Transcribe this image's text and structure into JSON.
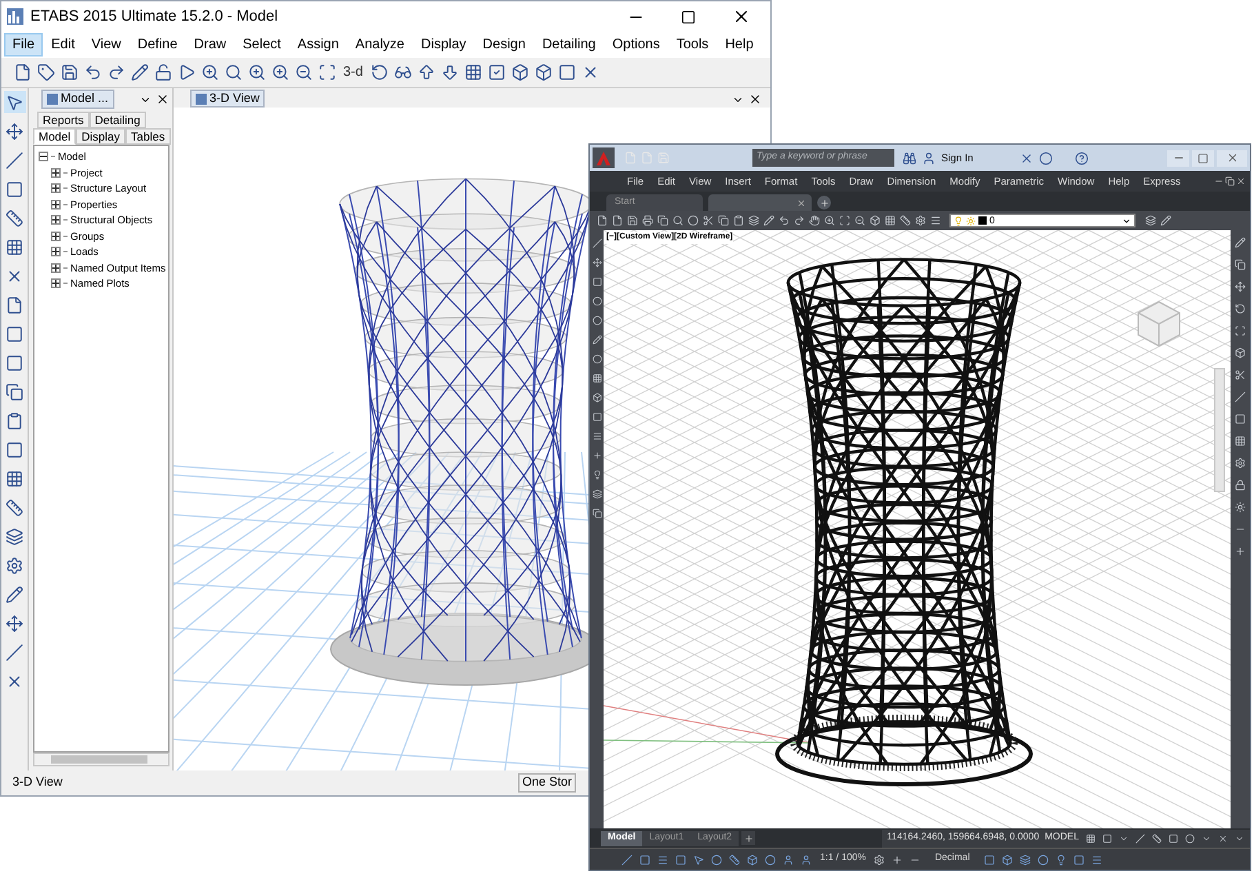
{
  "etabs": {
    "title": "ETABS 2015 Ultimate 15.2.0 - Model",
    "menu": [
      {
        "label": "File",
        "selected": true
      },
      {
        "label": "Edit",
        "selected": false
      },
      {
        "label": "View",
        "selected": false
      },
      {
        "label": "Define",
        "selected": false
      },
      {
        "label": "Draw",
        "selected": false
      },
      {
        "label": "Select",
        "selected": false
      },
      {
        "label": "Assign",
        "selected": false
      },
      {
        "label": "Analyze",
        "selected": false
      },
      {
        "label": "Display",
        "selected": false
      },
      {
        "label": "Design",
        "selected": false
      },
      {
        "label": "Detailing",
        "selected": false
      },
      {
        "label": "Options",
        "selected": false
      },
      {
        "label": "Tools",
        "selected": false
      },
      {
        "label": "Help",
        "selected": false
      }
    ],
    "toolbar_text_button": "3-d",
    "panel": {
      "title": "Model ...",
      "tab_rows": [
        [
          {
            "label": "Reports",
            "selected": false
          },
          {
            "label": "Detailing",
            "selected": false
          }
        ],
        [
          {
            "label": "Model",
            "selected": true
          },
          {
            "label": "Display",
            "selected": false
          },
          {
            "label": "Tables",
            "selected": false
          }
        ]
      ],
      "tree": {
        "label": "Model",
        "expanded": true,
        "children": [
          {
            "label": "Project",
            "expanded": false
          },
          {
            "label": "Structure Layout",
            "expanded": false
          },
          {
            "label": "Properties",
            "expanded": false
          },
          {
            "label": "Structural Objects",
            "expanded": false
          },
          {
            "label": "Groups",
            "expanded": false
          },
          {
            "label": "Loads",
            "expanded": false
          },
          {
            "label": "Named Output Items",
            "expanded": false
          },
          {
            "label": "Named Plots",
            "expanded": false
          }
        ]
      }
    },
    "view_tab": "3-D View",
    "status_bar": {
      "left": "3-D View",
      "right": "One Stor"
    }
  },
  "autocad": {
    "search": {
      "placeholder": "Type a keyword or phrase"
    },
    "sign_in": "Sign In",
    "menu": [
      "File",
      "Edit",
      "View",
      "Insert",
      "Format",
      "Tools",
      "Draw",
      "Dimension",
      "Modify",
      "Parametric",
      "Window",
      "Help",
      "Express"
    ],
    "file_tabs": [
      {
        "label": "Start",
        "selected": false
      }
    ],
    "layer": "0",
    "viewport_label": "[−][Custom View][2D Wireframe]",
    "layout_tabs": [
      {
        "label": "Model",
        "selected": true
      },
      {
        "label": "Layout1",
        "selected": false
      },
      {
        "label": "Layout2",
        "selected": false
      }
    ],
    "coordinates": "114164.2460, 159664.6948, 0.0000",
    "space": "MODEL",
    "scale": "1:1 / 100%",
    "units": "Decimal"
  }
}
